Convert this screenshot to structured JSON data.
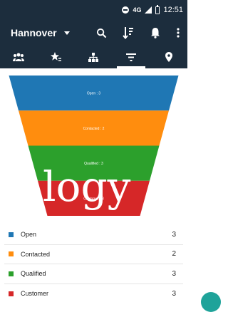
{
  "status_bar": {
    "network": "4G",
    "time": "12:51"
  },
  "app_bar": {
    "title": "Hannover"
  },
  "icons": {
    "dnd": "do-not-disturb-icon",
    "signal": "signal-icon",
    "battery": "battery-icon",
    "dropdown": "dropdown-caret-icon",
    "search": "search-icon",
    "sort": "sort-icon",
    "notifications": "bell-icon",
    "more": "more-vert-icon",
    "tab_contacts": "people-icon",
    "tab_favorites": "star-icon",
    "tab_hierarchy": "hierarchy-icon",
    "tab_funnel": "filter-icon",
    "tab_map": "location-pin-icon"
  },
  "funnel": {
    "stages": [
      {
        "label": "Open : 3",
        "color": "#1f77b4"
      },
      {
        "label": "Contacted : 2",
        "color": "#ff8d0e"
      },
      {
        "label": "Qualified : 3",
        "color": "#2ca02c"
      },
      {
        "label": "Customer : 3",
        "color": "#d62728"
      }
    ],
    "watermark": "logy"
  },
  "chart_data": {
    "type": "funnel",
    "categories": [
      "Open",
      "Contacted",
      "Qualified",
      "Customer"
    ],
    "values": [
      3,
      2,
      3,
      3
    ],
    "colors": [
      "#1f77b4",
      "#ff8d0e",
      "#2ca02c",
      "#d62728"
    ]
  },
  "legend": [
    {
      "label": "Open",
      "value": "3",
      "color": "#1f77b4"
    },
    {
      "label": "Contacted",
      "value": "2",
      "color": "#ff8d0e"
    },
    {
      "label": "Qualified",
      "value": "3",
      "color": "#2ca02c"
    },
    {
      "label": "Customer",
      "value": "3",
      "color": "#d62728"
    }
  ],
  "colors": {
    "bar": "#1c2d3d",
    "accent": "#1fa39a"
  }
}
